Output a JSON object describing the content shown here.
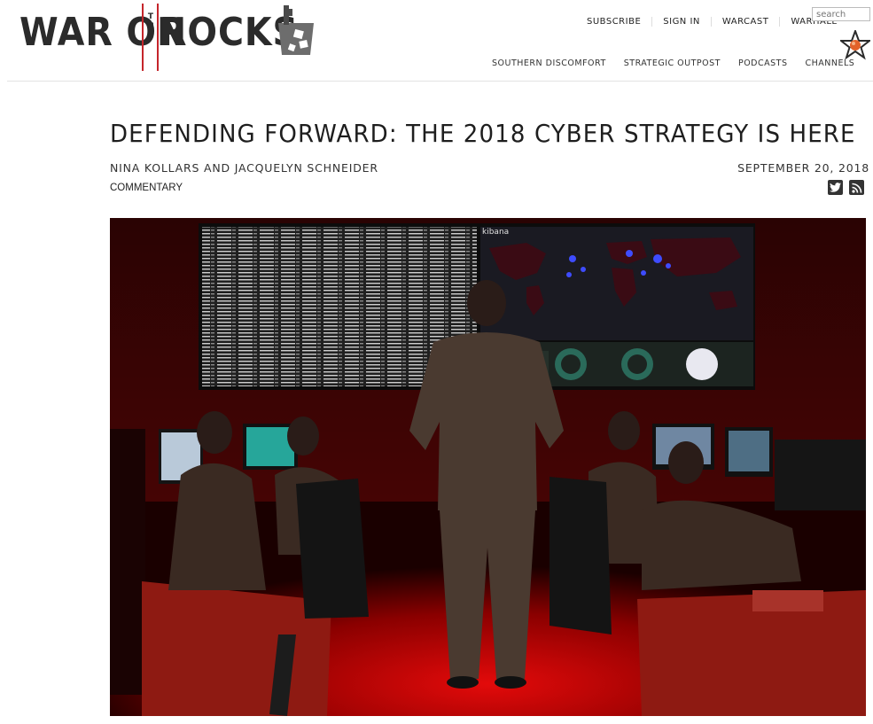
{
  "site": {
    "logo_left": "WAR ON",
    "logo_the": [
      "T",
      "H",
      "E"
    ],
    "logo_right": "ROCKS"
  },
  "top_nav": [
    "SUBSCRIBE",
    "SIGN IN",
    "WARCAST",
    "WARHALL"
  ],
  "search": {
    "placeholder": "search"
  },
  "section_nav": [
    "SOUTHERN DISCOMFORT",
    "STRATEGIC OUTPOST",
    "PODCASTS",
    "CHANNELS"
  ],
  "article": {
    "title": "DEFENDING FORWARD: THE 2018 CYBER STRATEGY IS HERE",
    "authors": "NINA KOLLARS AND JACQUELYN SCHNEIDER",
    "date": "SEPTEMBER 20, 2018",
    "category": "COMMENTARY"
  },
  "hero_screen": {
    "app_name": "kibana"
  },
  "icons": [
    "star-badge-icon",
    "twitter-icon",
    "rss-icon"
  ],
  "colors": {
    "brand_red": "#c5252b",
    "text_dark": "#1e1e1e",
    "scene_red": "#c00000"
  }
}
